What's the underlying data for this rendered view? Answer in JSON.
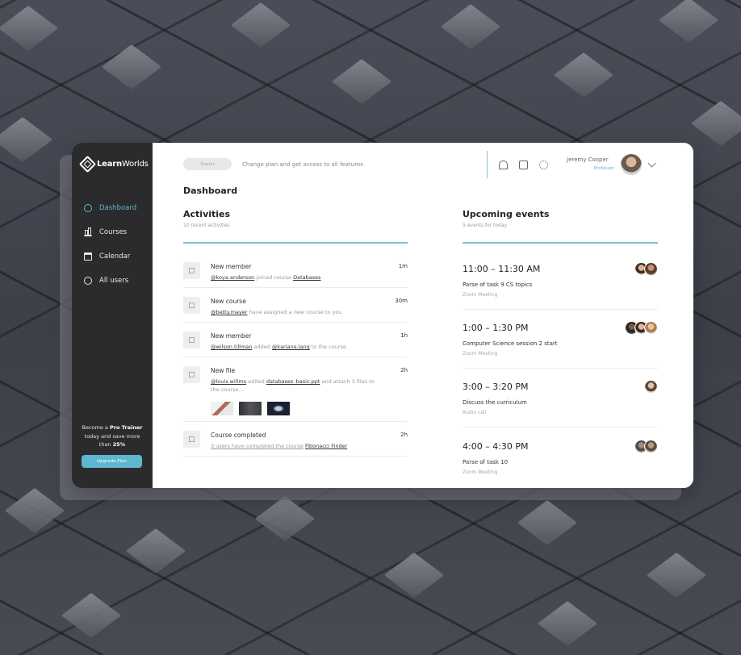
{
  "brand": {
    "name_bold": "Learn",
    "name_light": "Worlds"
  },
  "sidebar": {
    "items": [
      {
        "label": "Dashboard",
        "icon": "dashboard-icon",
        "active": true
      },
      {
        "label": "Courses",
        "icon": "bar-chart-icon",
        "active": false
      },
      {
        "label": "Calendar",
        "icon": "calendar-icon",
        "active": false
      },
      {
        "label": "All users",
        "icon": "user-circle-icon",
        "active": false
      }
    ],
    "promo": {
      "line1": "Become a",
      "highlight": "Pro Trainer",
      "line2": "today and save more",
      "line3": "than",
      "percent": "25%"
    },
    "upgrade_label": "Upgrade Plan"
  },
  "topbar": {
    "plan_pill": "Starter",
    "plan_text": "Change plan and get access to all features",
    "user_name": "Jeremy Cooper",
    "user_role": "Professor"
  },
  "page_title": "Dashboard",
  "activities": {
    "title": "Activities",
    "subtitle": "10 recent activities",
    "items": [
      {
        "title": "New member",
        "time": "1m",
        "user": "@koya.anderson",
        "verb": "joined course",
        "target": "Databases",
        "tail": ""
      },
      {
        "title": "New course",
        "time": "30m",
        "user": "@betty.mayer",
        "verb": "have assigned a new course to you",
        "target": "",
        "tail": ""
      },
      {
        "title": "New member",
        "time": "1h",
        "user": "@wilson.tillman",
        "verb": "added",
        "target": "@kariane.lang",
        "tail": "to the course"
      },
      {
        "title": "New file",
        "time": "2h",
        "user": "@louis.willms",
        "verb": "edited",
        "target": "databases_basic.ppt",
        "tail": "and attach 3 files to the course..."
      },
      {
        "title": "Course completed",
        "time": "2h",
        "user": "3 users have completed the course",
        "verb": "",
        "target": "Fibonacci Finder",
        "tail": ""
      }
    ]
  },
  "events": {
    "title": "Upcoming events",
    "subtitle": "5 events for today",
    "items": [
      {
        "time": "11:00 – 11:30 AM",
        "title": "Parse of task 9 CS topics",
        "type": "Zoom Meeting"
      },
      {
        "time": "1:00 – 1:30 PM",
        "title": "Computer Science session 2 start",
        "type": "Zoom Meeting"
      },
      {
        "time": "3:00 – 3:20 PM",
        "title": "Discuss the curriculum",
        "type": "Audio call"
      },
      {
        "time": "4:00 – 4:30 PM",
        "title": "Parse of task 10",
        "type": "Zoom Meeting"
      }
    ]
  },
  "colors": {
    "accent": "#5fb7cf",
    "sidebar_bg": "#2b2b2d",
    "background": "#44474f"
  }
}
